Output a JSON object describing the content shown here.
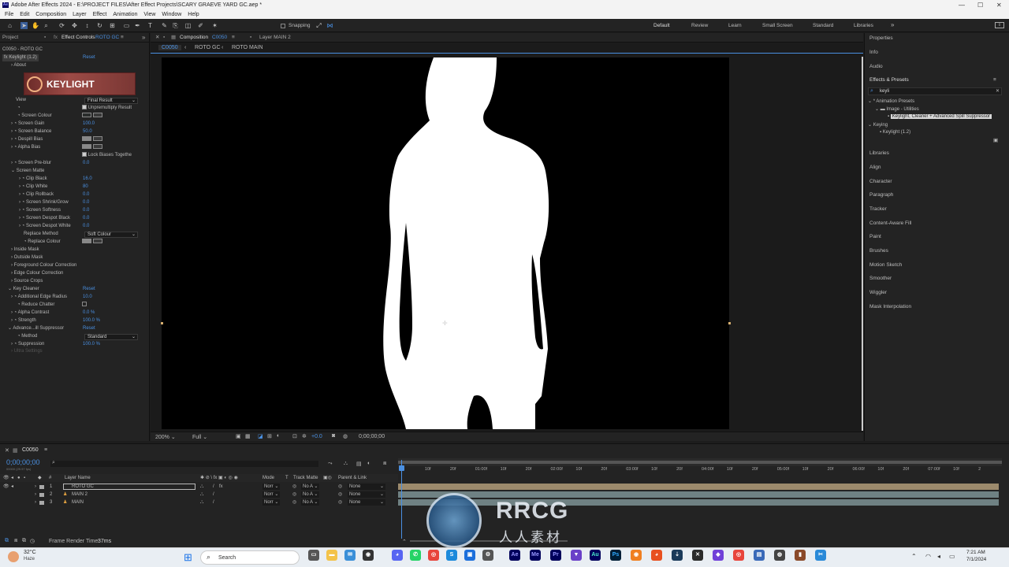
{
  "window": {
    "title": "Adobe After Effects 2024 - E:\\PROJECT FILES\\After Effect Projects\\SCARY GRAEVE YARD GC.aep *",
    "app_icon": "Ae",
    "minimize": "—",
    "maximize": "☐",
    "close": "✕"
  },
  "menu": [
    "File",
    "Edit",
    "Composition",
    "Layer",
    "Effect",
    "Animation",
    "View",
    "Window",
    "Help"
  ],
  "toolbar": {
    "snapping_label": "Snapping",
    "workspaces": [
      "Default",
      "Review",
      "Learn",
      "Small Screen",
      "Standard",
      "Libraries"
    ],
    "more": "»"
  },
  "left_tabs": {
    "project": "Project",
    "effect_controls": "Effect Controls",
    "effect_controls_target": "ROTO GC",
    "expand": "»"
  },
  "effect_controls": {
    "breadcrumb": "C0050 - ROTO GC",
    "effect_name": "Keylight (1.2)",
    "reset": "Reset",
    "about": "About",
    "banner_text": "KEYLIGHT",
    "view_label": "View",
    "view_value": "Final Result",
    "unpremultiply": "Unpremultiply Result",
    "screen_colour": "Screen Colour",
    "screen_colour_hex": "#2a2d2c",
    "screen_gain_label": "Screen Gain",
    "screen_gain": "100.0",
    "screen_balance_label": "Screen Balance",
    "screen_balance": "50.0",
    "despill_bias": "Despill Bias",
    "alpha_bias": "Alpha Bias",
    "lock_biases": "Lock Biases Togethe",
    "screen_preblur_label": "Screen Pre-blur",
    "screen_preblur": "0.0",
    "screen_matte": "Screen Matte",
    "clip_black_label": "Clip Black",
    "clip_black": "16.0",
    "clip_white_label": "Clip White",
    "clip_white": "80",
    "clip_rollback_label": "Clip Rollback",
    "clip_rollback": "0.0",
    "shrink_grow_label": "Screen Shrink/Grow",
    "shrink_grow": "0.0",
    "softness_label": "Screen Softness",
    "softness": "0.0",
    "despot_black_label": "Screen Despot Black",
    "despot_black": "0.0",
    "despot_white_label": "Screen Despot White",
    "despot_white": "0.0",
    "replace_method_label": "Replace Method",
    "replace_method": "Soft Colour",
    "replace_colour": "Replace Colour",
    "inside_mask": "Inside Mask",
    "outside_mask": "Outside Mask",
    "fg_colour_correction": "Foreground Colour Correction",
    "edge_colour_correction": "Edge Colour Correction",
    "source_crops": "Source Crops",
    "key_cleaner": "Key Cleaner",
    "key_cleaner_reset": "Reset",
    "additional_edge_radius_label": "Additional Edge Radius",
    "additional_edge_radius": "10.0",
    "reduce_chatter": "Reduce Chatter",
    "alpha_contrast_label": "Alpha Contrast",
    "alpha_contrast": "0.0 %",
    "strength_label": "Strength",
    "strength": "100.0 %",
    "advanced_spill": "Advance...ill Suppressor",
    "advanced_spill_reset": "Reset",
    "method_label": "Method",
    "method_value": "Standard",
    "suppression_label": "Suppression",
    "suppression": "100.0 %",
    "ultra_settings": "Ultra Settings"
  },
  "composition": {
    "tab_label": "Composition",
    "tab_target": "C0050",
    "layer_tab": "Layer  MAIN 2",
    "breadcrumbs": [
      "C0050",
      "ROTO GC",
      "ROTO MAIN"
    ],
    "zoom": "200%",
    "resolution": "Full",
    "exposure": "+0.0",
    "timecode": "0;00;00;00"
  },
  "right_panel": {
    "properties": "Properties",
    "info": "Info",
    "audio": "Audio",
    "effects_presets": "Effects & Presets",
    "search_value": "keyli",
    "animation_presets": "* Animation Presets",
    "image_utilities": "Image - Utilities",
    "preset_item": "Keylight, Cleaner + Advanced Spill Suppressor",
    "keying": "Keying",
    "keylight_item": "Keylight (1.2)",
    "panels": [
      "Libraries",
      "Align",
      "Character",
      "Paragraph",
      "Tracker",
      "Content-Aware Fill",
      "Paint",
      "Brushes",
      "Motion Sketch",
      "Smoother",
      "Wiggler",
      "Mask Interpolation"
    ]
  },
  "timeline": {
    "comp_tab": "C0050",
    "timecode": "0;00;00;00",
    "timecode_sub": "00000 (29.97 fps)",
    "search_placeholder": "",
    "col_layer_name": "Layer Name",
    "col_mode": "Mode",
    "col_t": "T",
    "col_track_matte": "Track Matte",
    "col_parent": "Parent & Link",
    "ruler": [
      "0f",
      "10f",
      "20f",
      "01:00f",
      "10f",
      "20f",
      "02:00f",
      "10f",
      "20f",
      "03:00f",
      "10f",
      "20f",
      "04:00f",
      "10f",
      "20f",
      "05:00f",
      "10f",
      "20f",
      "06:00f",
      "10f",
      "20f",
      "07:00f",
      "10f",
      "2"
    ],
    "layers": [
      {
        "num": "1",
        "name": "ROTO GC",
        "mode": "Norr",
        "matte": "No A",
        "parent": "None"
      },
      {
        "num": "2",
        "name": "MAIN 2",
        "mode": "Norr",
        "matte": "No A",
        "parent": "None"
      },
      {
        "num": "3",
        "name": "MAIN",
        "mode": "Norr",
        "matte": "No A",
        "parent": "None"
      }
    ],
    "frame_render_label": "Frame Render Time:",
    "frame_render_value": "37ms"
  },
  "watermark": {
    "logo": "RRCG",
    "subtitle": "人人素材"
  },
  "taskbar": {
    "temp": "32°C",
    "weather": "Haze",
    "search": "Search",
    "time": "7:21 AM",
    "date": "7/1/2024",
    "apps": [
      "Ae",
      "Me",
      "Pr",
      "Au",
      "Ps"
    ]
  }
}
